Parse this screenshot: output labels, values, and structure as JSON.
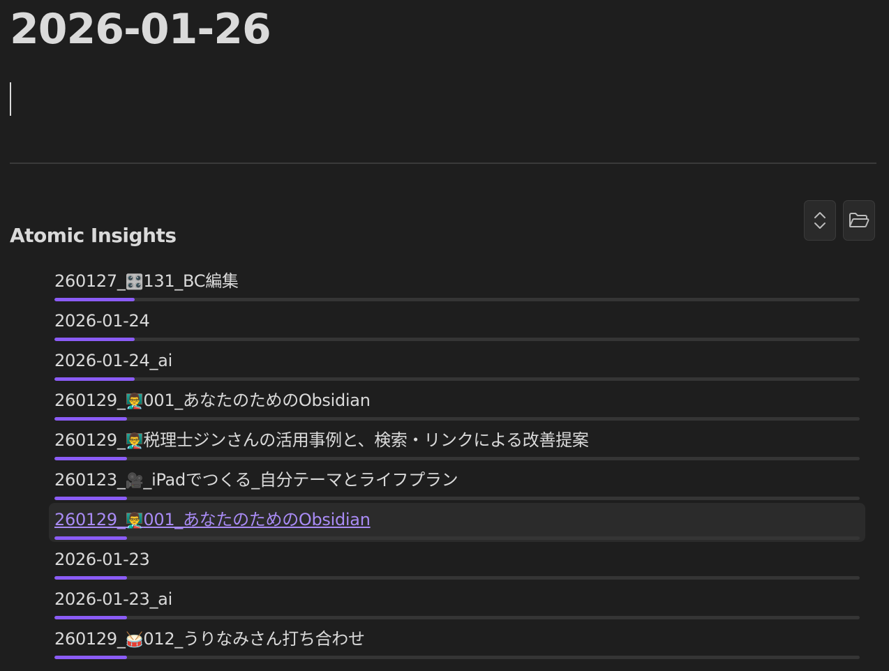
{
  "note": {
    "title": "2026-01-26"
  },
  "insights": {
    "heading": "Atomic Insights",
    "collapse_icon": "chevrons-up-down-icon",
    "folder_icon": "folder-open-icon",
    "accent_color": "#8b5cf6",
    "items": [
      {
        "prefix": "260127_",
        "emoji": "🎛️",
        "suffix": "131_BC編集",
        "progress": 0.1
      },
      {
        "prefix": "2026-01-24",
        "emoji": "",
        "suffix": "",
        "progress": 0.1
      },
      {
        "prefix": "2026-01-24_ai",
        "emoji": "",
        "suffix": "",
        "progress": 0.1
      },
      {
        "prefix": "260129_",
        "emoji": "👨‍🏫",
        "suffix": "001_あなたのためのObsidian",
        "progress": 0.09
      },
      {
        "prefix": "260129_",
        "emoji": "👨‍🏫",
        "suffix": "税理士ジンさんの活用事例と、検索・リンクによる改善提案",
        "progress": 0.09
      },
      {
        "prefix": "260123_",
        "emoji": "🎥",
        "suffix": "_iPadでつくる_自分テーマとライフプラン",
        "progress": 0.09
      },
      {
        "prefix": "260129_",
        "emoji": "👨‍🏫",
        "suffix": "001_あなたのためのObsidian",
        "progress": 0.09,
        "active": true
      },
      {
        "prefix": "2026-01-23",
        "emoji": "",
        "suffix": "",
        "progress": 0.09
      },
      {
        "prefix": "2026-01-23_ai",
        "emoji": "",
        "suffix": "",
        "progress": 0.09
      },
      {
        "prefix": "260129_",
        "emoji": "🥁",
        "suffix": "012_うりなみさん打ち合わせ",
        "progress": 0.09
      }
    ]
  }
}
